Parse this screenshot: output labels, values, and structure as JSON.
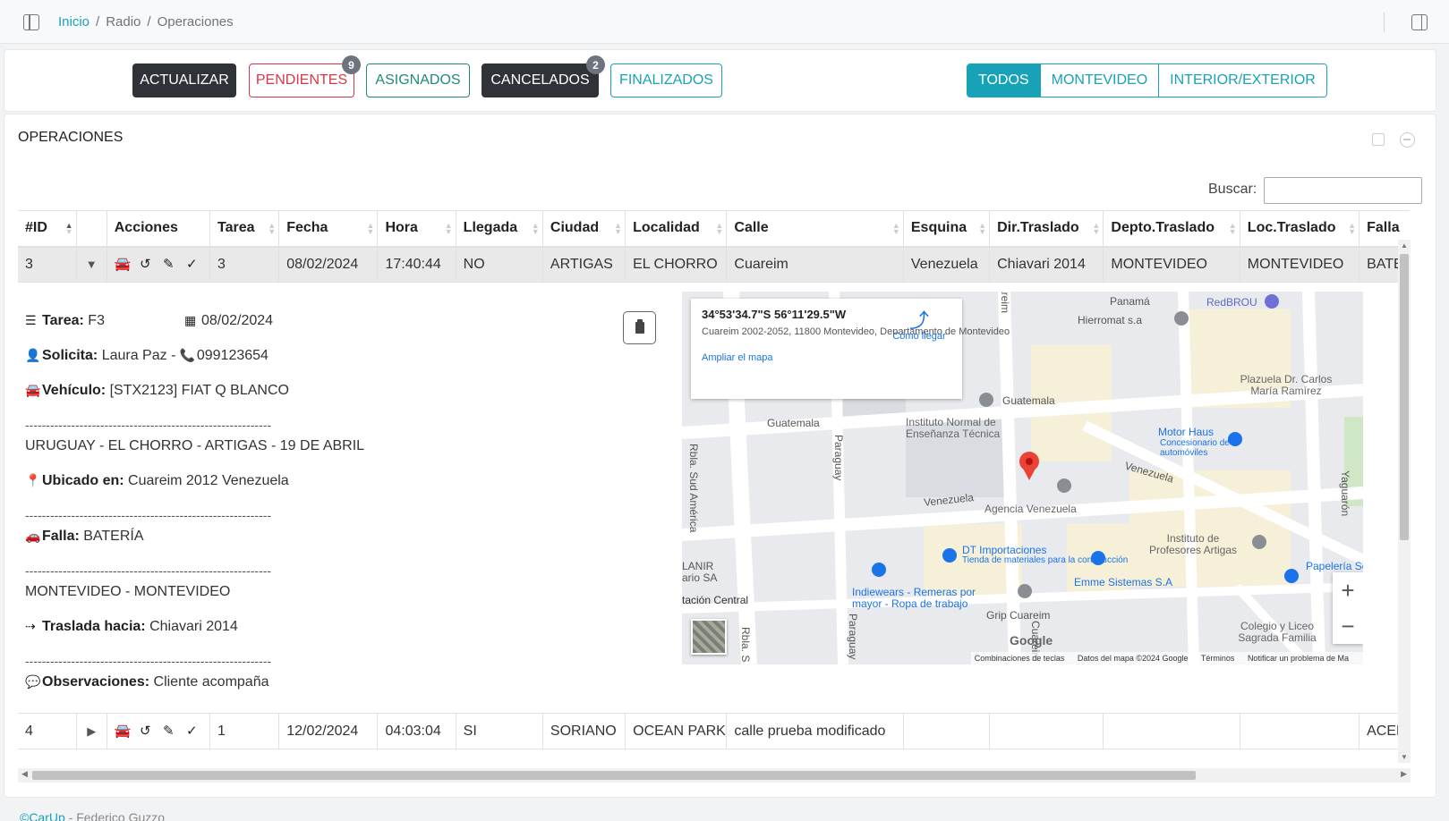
{
  "breadcrumb": {
    "home": "Inicio",
    "section": "Radio",
    "current": "Operaciones"
  },
  "filters": {
    "actualizar": "ACTUALIZAR",
    "pendientes": "PENDIENTES",
    "pendientes_count": "9",
    "asignados": "ASIGNADOS",
    "cancelados": "CANCELADOS",
    "cancelados_count": "2",
    "finalizados": "FINALIZADOS"
  },
  "region_tabs": {
    "todos": "TODOS",
    "montevideo": "MONTEVIDEO",
    "interior": "INTERIOR/EXTERIOR",
    "active": "TODOS"
  },
  "card": {
    "title": "OPERACIONES"
  },
  "search": {
    "label": "Buscar:",
    "value": ""
  },
  "table": {
    "headers": [
      "#ID",
      "",
      "Acciones",
      "Tarea",
      "Fecha",
      "Hora",
      "Llegada",
      "Ciudad",
      "Localidad",
      "Calle",
      "Esquina",
      "Dir.Traslado",
      "Depto.Traslado",
      "Loc.Traslado",
      "Falla"
    ],
    "rows": [
      {
        "id": "3",
        "toggle": "▼",
        "tarea": "3",
        "fecha": "08/02/2024",
        "hora": "17:40:44",
        "llegada": "NO",
        "ciudad": "ARTIGAS",
        "localidad": "EL CHORRO",
        "calle": "Cuareim",
        "esquina": "Venezuela",
        "dir_traslado": "Chiavari 2014",
        "depto_traslado": "MONTEVIDEO",
        "loc_traslado": "MONTEVIDEO",
        "falla": "BATERÍA"
      },
      {
        "id": "4",
        "toggle": "▶",
        "tarea": "1",
        "fecha": "12/02/2024",
        "hora": "04:03:04",
        "llegada": "SI",
        "ciudad": "SORIANO",
        "localidad": "OCEAN PARK",
        "calle": "calle prueba modificado",
        "esquina": "",
        "dir_traslado": "",
        "depto_traslado": "",
        "loc_traslado": "",
        "falla": "ACELERADOR"
      }
    ]
  },
  "detail": {
    "tarea_label": "Tarea:",
    "tarea_value": "F3",
    "fecha": "08/02/2024",
    "solicita_label": "Solicita:",
    "solicita_value": "Laura Paz -",
    "telefono": "099123654",
    "vehiculo_label": "Vehículo:",
    "vehiculo_value": "[STX2123] FIAT Q BLANCO",
    "separator": "-----------------------------------------------------------",
    "ubicacion": "URUGUAY - EL CHORRO - ARTIGAS - 19 DE ABRIL",
    "ubicado_label": "Ubicado en:",
    "ubicado_value": "Cuareim 2012 Venezuela",
    "falla_label": "Falla:",
    "falla_value": "BATERÍA",
    "destino": "MONTEVIDEO - MONTEVIDEO",
    "traslada_label": "Traslada hacia:",
    "traslada_value": "Chiavari 2014",
    "obs_label": "Observaciones:",
    "obs_value": "Cliente acompaña"
  },
  "map": {
    "coord": "34°53'34.7\"S 56°11'29.5\"W",
    "address": "Cuareim 2002-2052, 11800 Montevideo, Departamento de Montevideo",
    "directions": "Cómo llegar",
    "enlarge": "Ampliar el mapa",
    "zoom_in": "+",
    "zoom_out": "−",
    "logo": "Google",
    "footer": {
      "shortcuts": "Combinaciones de teclas",
      "data": "Datos del mapa ©2024 Google",
      "terms": "Términos",
      "report": "Notificar un problema de Ma"
    },
    "labels": [
      "Panamá",
      "RedBROU",
      "Hierromat s.a",
      "Guatemala",
      "Guatemala",
      "Instituto Normal de Enseñanza Técnica",
      "Motor Haus",
      "Concesionario de automóviles",
      "Plazuela Dr. Carlos María Ramírez",
      "Venezuela",
      "Venezuela",
      "Agencia Venezuela",
      "Rbla. Sud América",
      "Paraguay",
      "Yaguarón",
      "DT Importaciones",
      "Tienda de materiales para la construcción",
      "Instituto de Profesores Artigas",
      "Papelería Servi",
      "LANIR",
      "ario SA",
      "tación Central",
      "Indiewears - Remeras por mayor - Ropa de trabajo",
      "Emme Sistemas S.A",
      "Grip Cuareim",
      "Colegio y Liceo Sagrada Familia",
      "areim",
      "Rbla. S",
      "Paraguay",
      "Cuareim"
    ]
  },
  "footer": {
    "copy": "©CarUp",
    "author": "- Federico Guzzo"
  },
  "colors": {
    "accent": "#17a2b8",
    "danger": "#dc3545",
    "success": "#1f8a7a",
    "dark": "#2f3338"
  }
}
